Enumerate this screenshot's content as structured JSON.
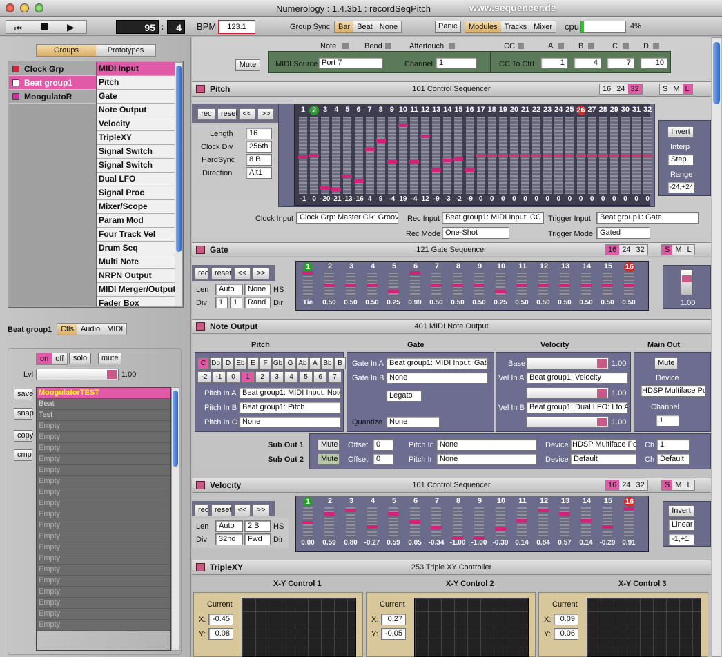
{
  "window": {
    "title": "Numerology : 1.4.3b1 : recordSeqPitch",
    "watermark": "www.sequencer.de"
  },
  "toolbar": {
    "bars": "95",
    "beats": "4",
    "bpm_label": "BPM",
    "bpm": "123.1",
    "group_sync_label": "Group Sync",
    "sync_options": [
      "Bar",
      "Beat",
      "None"
    ],
    "panic": "Panic",
    "views": [
      "Modules",
      "Tracks",
      "Mixer"
    ],
    "cpu_label": "cpu",
    "cpu_percent": "4%",
    "cpu_value": 0.04
  },
  "left": {
    "tabs": [
      "Groups",
      "Prototypes"
    ],
    "groups": [
      {
        "label": "Clock Grp",
        "color": "#e0203a"
      },
      {
        "label": "Beat group1",
        "color": "#ffffff"
      },
      {
        "label": "MoogulatoR",
        "color": "#d030a0"
      }
    ],
    "modules": [
      "MIDI Input",
      "Pitch",
      "Gate",
      "Note Output",
      "Velocity",
      "TripleXY",
      "Signal Switch",
      "Signal Switch",
      "Dual LFO",
      "Signal Proc",
      "Mixer/Scope",
      "Param Mod",
      "Four Track Vel",
      "Drum Seq",
      "Multi Note",
      "NRPN Output",
      "MIDI Merger/Output",
      "Fader Box"
    ],
    "group_name": "Beat group1",
    "group_tabs": [
      "Ctls",
      "Audio",
      "MIDI"
    ],
    "on": "on",
    "off": "off",
    "solo": "solo",
    "mute": "mute",
    "lvl_label": "Lvl",
    "lvl_value": "1.00",
    "side_buttons": [
      "save",
      "snap",
      "copy",
      "cmp"
    ],
    "presets": [
      "MoogulatorTEST",
      "Beat",
      "Test",
      "Empty",
      "Empty",
      "Empty",
      "Empty",
      "Empty",
      "Empty",
      "Empty",
      "Empty",
      "Empty",
      "Empty",
      "Empty",
      "Empty",
      "Empty",
      "Empty",
      "Empty",
      "Empty",
      "Empty",
      "Empty",
      "Empty"
    ]
  },
  "midi": {
    "mute": "Mute",
    "note": "Note",
    "bend": "Bend",
    "aftertouch": "Aftertouch",
    "cc": "CC",
    "a": "A",
    "b": "B",
    "c": "C",
    "d": "D",
    "source_label": "MIDI Source",
    "source": "Port 7",
    "channel_label": "Channel",
    "channel": "1",
    "cc_to_ctrl": "CC To Ctrl",
    "ccs": [
      "1",
      "4",
      "7",
      "10"
    ]
  },
  "pitch": {
    "title": "Pitch",
    "center": "101 Control Sequencer",
    "tabs": [
      "16",
      "24",
      "32"
    ],
    "sml": [
      "S",
      "M",
      "L"
    ],
    "rec": "rec",
    "reset": "reset",
    "prev": "<<",
    "next": ">>",
    "length_label": "Length",
    "length": "16",
    "clockdiv_label": "Clock Div",
    "clockdiv": "256th",
    "hardsync_label": "HardSync",
    "hardsync": "8 B",
    "direction_label": "Direction",
    "direction": "Alt1",
    "steps": [
      "1",
      "2",
      "3",
      "4",
      "5",
      "6",
      "7",
      "8",
      "9",
      "10",
      "11",
      "12",
      "13",
      "14",
      "15",
      "16",
      "17",
      "18",
      "19",
      "20",
      "21",
      "22",
      "23",
      "24",
      "25",
      "26",
      "27",
      "28",
      "29",
      "30",
      "31",
      "32"
    ],
    "values": [
      -1,
      0,
      -20,
      -21,
      -13,
      -16,
      4,
      9,
      -4,
      19,
      -4,
      12,
      -9,
      -3,
      -2,
      -9,
      0,
      0,
      0,
      0,
      0,
      0,
      0,
      0,
      0,
      0,
      0,
      0,
      0,
      0,
      0,
      0
    ],
    "invert": "Invert",
    "interp_label": "Interp",
    "interp": "Step",
    "range_label": "Range",
    "range": "-24,+24",
    "clock_input_label": "Clock Input",
    "clock_input": "Clock Grp: Master Clk: Groove",
    "rec_input_label": "Rec Input",
    "rec_input": "Beat group1: MIDI Input: CC A",
    "trigger_input_label": "Trigger Input",
    "trigger_input": "Beat group1: Gate",
    "rec_mode_label": "Rec Mode",
    "rec_mode": "One-Shot",
    "trigger_mode_label": "Trigger Mode",
    "trigger_mode": "Gated"
  },
  "gate": {
    "title": "Gate",
    "center": "121 Gate Sequencer",
    "tabs": [
      "16",
      "24",
      "32"
    ],
    "sml": [
      "S",
      "M",
      "L"
    ],
    "rec": "rec",
    "reset": "reset",
    "prev": "<<",
    "next": ">>",
    "len_label": "Len",
    "len": "Auto",
    "len2": "None",
    "hs": "HS",
    "div_label": "Div",
    "div1": "1",
    "div2": "1",
    "rand": "Rand",
    "dir": "Dir",
    "steps": [
      "1",
      "2",
      "3",
      "4",
      "5",
      "6",
      "7",
      "8",
      "9",
      "10",
      "11",
      "12",
      "13",
      "14",
      "15",
      "16"
    ],
    "labels": [
      "Tie",
      "0.50",
      "0.50",
      "0.50",
      "0.25",
      "0.99",
      "0.50",
      "0.50",
      "0.50",
      "0.25",
      "0.50",
      "0.50",
      "0.50",
      "0.50",
      "0.50",
      "0.50"
    ],
    "values": [
      1.0,
      0.5,
      0.5,
      0.5,
      0.25,
      0.99,
      0.5,
      0.5,
      0.5,
      0.25,
      0.5,
      0.5,
      0.5,
      0.5,
      0.5,
      0.5
    ],
    "fader": "1.00"
  },
  "note": {
    "title": "Note Output",
    "center": "401 MIDI Note Output",
    "pitch_hdr": "Pitch",
    "gate_hdr": "Gate",
    "vel_hdr": "Velocity",
    "main_hdr": "Main Out",
    "keys": [
      "C",
      "Db",
      "D",
      "Eb",
      "E",
      "F",
      "Gb",
      "G",
      "Ab",
      "A",
      "Bb",
      "B"
    ],
    "octs": [
      "-2",
      "-1",
      "0",
      "1",
      "2",
      "3",
      "4",
      "5",
      "6",
      "7"
    ],
    "pitch_a_label": "Pitch In A",
    "pitch_a": "Beat group1: MIDI Input: NoteNum",
    "pitch_b_label": "Pitch In B",
    "pitch_b": "Beat group1: Pitch",
    "pitch_c_label": "Pitch In C",
    "pitch_c": "None",
    "gate_a_label": "Gate In A",
    "gate_a": "Beat group1: MIDI Input: Gate",
    "gate_b_label": "Gate In B",
    "gate_b": "None",
    "legato": "Legato",
    "quantize_label": "Quantize",
    "quantize": "None",
    "base_label": "Base",
    "base_val": "1.00",
    "vel_a_label": "Vel In A",
    "vel_a": "Beat group1: Velocity",
    "vel_a_val": "1.00",
    "vel_b_label": "Vel In B",
    "vel_b": "Beat group1: Dual LFO: Lfo AB",
    "vel_b_val": "1.00",
    "mute": "Mute",
    "device_label": "Device",
    "device": "HDSP Multiface Port",
    "channel_label": "Channel",
    "channel": "1",
    "sub1_label": "Sub Out 1",
    "sub2_label": "Sub Out 2",
    "offset_label": "Offset",
    "offset": "0",
    "pitchin_label": "Pitch In",
    "pitchin": "None",
    "sub_device_label": "Device",
    "sub1_device": "HDSP Multiface Port",
    "sub2_device": "Default",
    "ch_label": "Ch",
    "sub1_ch": "1",
    "sub2_ch": "Default"
  },
  "velocity": {
    "title": "Velocity",
    "center": "101 Control Sequencer",
    "tabs": [
      "16",
      "24",
      "32"
    ],
    "sml": [
      "S",
      "M",
      "L"
    ],
    "rec": "rec",
    "reset": "reset",
    "prev": "<<",
    "next": ">>",
    "len_label": "Len",
    "len": "Auto",
    "len2": "2 B",
    "hs": "HS",
    "div_label": "Div",
    "div": "32nd",
    "dir_val": "Fwd",
    "dir": "Dir",
    "steps": [
      "1",
      "2",
      "3",
      "4",
      "5",
      "6",
      "7",
      "8",
      "9",
      "10",
      "11",
      "12",
      "13",
      "14",
      "15",
      "16"
    ],
    "labels": [
      "0.00",
      "0.59",
      "0.80",
      "-0.27",
      "0.59",
      "0.05",
      "-0.34",
      "-1.00",
      "-1.00",
      "-0.39",
      "0.14",
      "0.84",
      "0.57",
      "0.14",
      "-0.29",
      "0.91"
    ],
    "values": [
      0.0,
      0.59,
      0.8,
      -0.27,
      0.59,
      0.05,
      -0.34,
      -1.0,
      -1.0,
      -0.39,
      0.14,
      0.84,
      0.57,
      0.14,
      -0.29,
      0.91
    ],
    "invert": "Invert",
    "interp": "Linear",
    "range": "-1,+1"
  },
  "triplexy": {
    "title": "TripleXY",
    "center": "253 Triple XY Controller",
    "controls": [
      {
        "title": "X-Y Control 1",
        "x": "-0.45",
        "y": "0.08"
      },
      {
        "title": "X-Y Control 2",
        "x": "0.27",
        "y": "-0.05"
      },
      {
        "title": "X-Y Control 3",
        "x": "0.09",
        "y": "0.06"
      }
    ],
    "current": "Current",
    "xl": "X:",
    "yl": "Y:"
  }
}
